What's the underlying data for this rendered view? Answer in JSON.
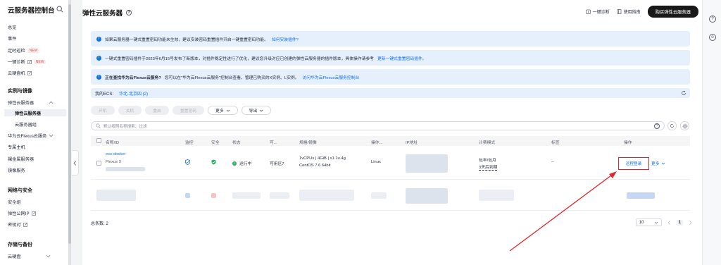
{
  "sidebar": {
    "title": "云服务器控制台",
    "items": [
      {
        "label": "总览"
      },
      {
        "label": "事件"
      },
      {
        "label": "定时巡检",
        "badge": "NEW"
      },
      {
        "label": "一键诊断",
        "badge": "NEW"
      },
      {
        "label": "云硬盘机"
      }
    ],
    "group1": "实例与镜像",
    "group1_items": [
      "弹性云服务器",
      "弹性云服务器",
      "云服务器组",
      "华为云Flexus云服务",
      "专属主机",
      "裸金属服务器",
      "镜像服务"
    ],
    "group2": "网络与安全",
    "group2_items": [
      "安全组",
      "弹性公网IP",
      "密钥对"
    ],
    "group3": "存储与备份",
    "group3_items": [
      "云硬盘"
    ]
  },
  "header": {
    "title": "弹性云服务器",
    "diag": "一键诊断",
    "guide": "使用指南",
    "buy": "购买弹性云服务器"
  },
  "notices": [
    {
      "text": "如果云服务器一键式重置密码功能未生效，建议安装密码重置插件开启一键重置密码功能。",
      "link": "如何安装插件?"
    },
    {
      "text": "一键式重置密码插件于2023年6月15号发布了新版本，对插件稳定性进行了优化，建议您升级对应已创建的弹性云服务器的插件版本，具体操作请参考",
      "link": "更新一键式重置密码插件。"
    },
    {
      "bold": "正在查找华为云Flexus云服务?",
      "text": "您可以在\"华为云Flexus云服务\"控制台查看、管理已购买的X实例、L实例。",
      "link": "访问华为云Flexus云服务控制台"
    }
  ],
  "my_ecs": {
    "label": "我的ECS:",
    "region": "华北-北京四 (2)"
  },
  "toolbar": {
    "buttons": [
      "开机",
      "关机",
      "重启",
      "重置密码"
    ],
    "more": "更多",
    "export": "导出"
  },
  "search": {
    "placeholder": "默认按照名称搜索、过滤"
  },
  "table": {
    "headers": [
      "名称/ID",
      "监控",
      "安全",
      "状态",
      "可...",
      "规格/镜像",
      "操作...",
      "IP地址",
      "计费模式",
      "标签",
      "操作"
    ],
    "rows": [
      {
        "name": "ecs-docker",
        "id": "Flexus X",
        "status": "运行中",
        "zone": "可用区7",
        "spec": "1vCPUs | 4GiB | x1.1u.4g",
        "image": "CentOS 7.6 64bit",
        "os": "Linux",
        "billing1": "包年/包月",
        "billing2": "3天后到期",
        "tag": "--",
        "remote": "远程登录",
        "more": "更多"
      }
    ]
  },
  "footer": {
    "total": "总条数: 2",
    "page_size": "10",
    "page": "1"
  },
  "colors": {
    "accent": "#0a6df0",
    "highlight": "#e0262b",
    "running": "#2fb164"
  }
}
